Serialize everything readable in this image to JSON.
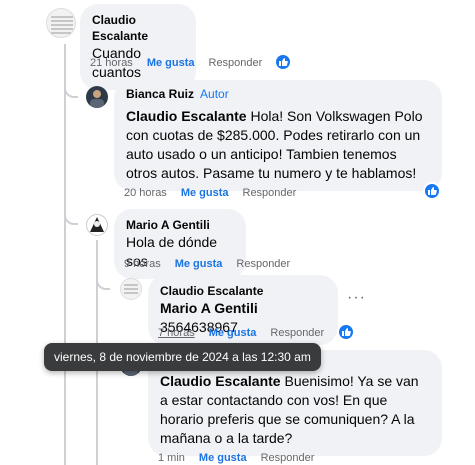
{
  "comments": [
    {
      "author": "Claudio Escalante",
      "text": "Cuando cuantos",
      "time": "21 horas",
      "like": "Me gusta",
      "reply": "Responder"
    },
    {
      "author": "Bianca Ruiz",
      "author_tag": "Autor",
      "mention": "Claudio Escalante",
      "text": " Hola! Son Volkswagen Polo con cuotas de $285.000. Podes retirarlo con un auto usado o un anticipo! Tambien tenemos otros autos. Pasame tu numero y te hablamos!",
      "time": "20 horas",
      "like": "Me gusta",
      "reply": "Responder"
    },
    {
      "author": "Mario A Gentili",
      "text": "Hola de dónde sos",
      "time": "9 horas",
      "like": "Me gusta",
      "reply": "Responder"
    },
    {
      "author": "Claudio Escalante",
      "mention": "Mario A Gentili",
      "text": " 3564638967",
      "time": "7 horas",
      "like": "Me gusta",
      "reply": "Responder"
    },
    {
      "author": "Bianca Ruiz",
      "mention": "Claudio Escalante",
      "text": " Buenisimo! Ya se van a estar contactando con vos! En que horario preferis que se comuniquen? A la mañana o a la tarde?",
      "time": "1 min",
      "like": "Me gusta",
      "reply": "Responder"
    }
  ],
  "tooltip": "viernes, 8 de noviembre de 2024 a las 12:30 am",
  "more_menu": "···",
  "colors": {
    "accent": "#1877f2",
    "bubble": "#f0f2f5",
    "muted": "#65676b"
  }
}
